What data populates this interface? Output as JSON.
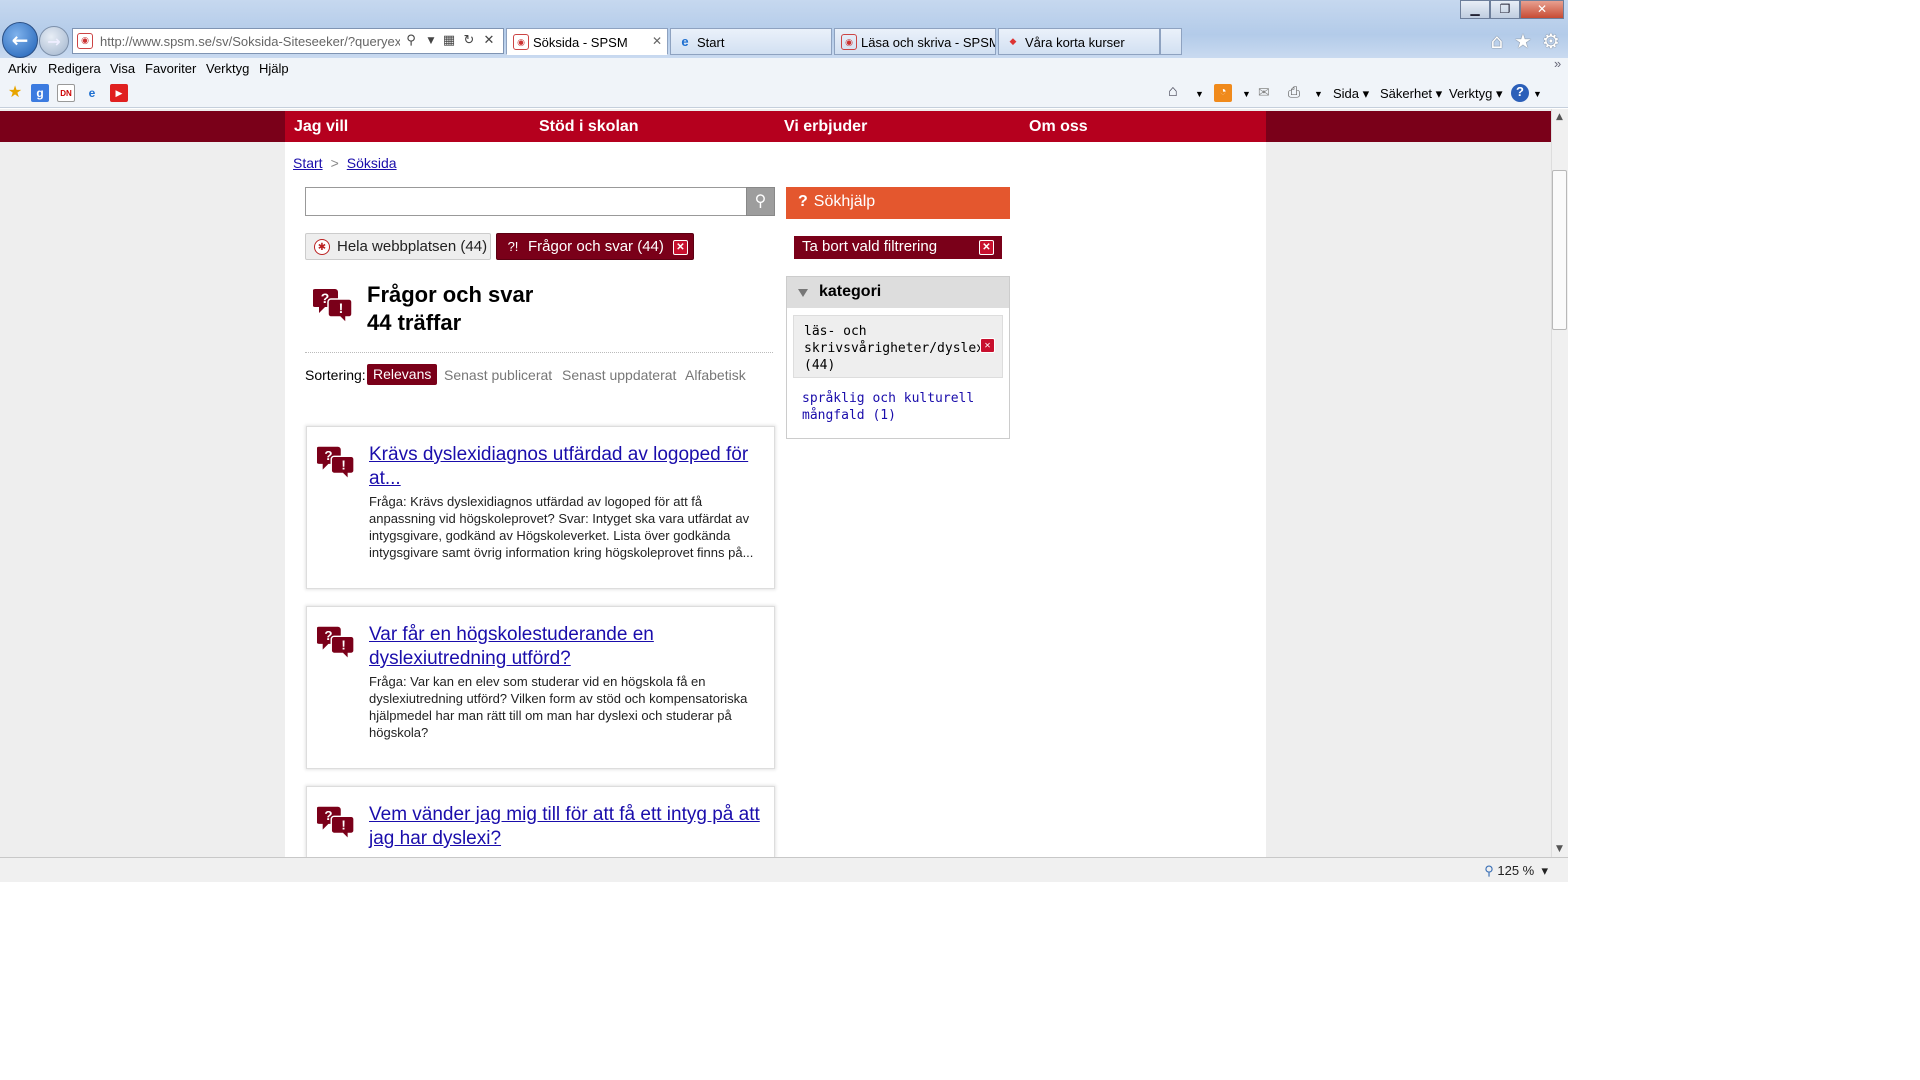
{
  "browser": {
    "address": "http://www.spsm.se/sv/Soksida-Siteseeker/?queryex=(h",
    "tabs": [
      {
        "label": "Söksida - SPSM"
      },
      {
        "label": "Start"
      },
      {
        "label": "Läsa och skriva - SPSM"
      },
      {
        "label": "Våra korta kurser"
      }
    ],
    "menu": [
      "Arkiv",
      "Redigera",
      "Visa",
      "Favoriter",
      "Verktyg",
      "Hjälp"
    ],
    "commands": {
      "page": "Sida",
      "safety": "Säkerhet",
      "tools": "Verktyg"
    },
    "zoom": "125 %"
  },
  "site": {
    "nav": [
      "Jag vill",
      "Stöd i skolan",
      "Vi erbjuder",
      "Om oss"
    ],
    "breadcrumb": {
      "start": "Start",
      "sep": ">",
      "current": "Söksida"
    },
    "search": {
      "value": "",
      "help_label": "Sökhjälp"
    },
    "filters": {
      "whole_site": "Hela webbplatsen (44)",
      "qa": "Frågor och svar (44)",
      "remove": "Ta bort vald filtrering"
    },
    "category": {
      "heading": "kategori",
      "selected": "läs- och skrivsvårigheter/dyslexi (44)",
      "other": "språklig och kulturell mångfald (1)"
    },
    "results": {
      "title": "Frågor och svar",
      "count": "44 träffar"
    },
    "sort": {
      "label": "Sortering:",
      "options": [
        "Relevans",
        "Senast publicerat",
        "Senast uppdaterat",
        "Alfabetisk"
      ]
    },
    "items": [
      {
        "title": "Krävs dyslexidiagnos utfärdad av logoped för at...",
        "text": "Fråga: Krävs dyslexidiagnos utfärdad av logoped för att få anpassning vid högskoleprovet? Svar: Intyget ska vara utfärdat av intygsgivare, godkänd av Högskoleverket. Lista över godkända intygsgivare samt övrig information kring högskoleprovet finns på..."
      },
      {
        "title": "Var får en högskolestuderande en dyslexiutredning utförd?",
        "text": "Fråga: Var kan en elev som studerar vid en högskola få en dyslexiutredning utförd? Vilken form av stöd och kompensatoriska hjälpmedel har man rätt till om man har dyslexi och studerar på högskola?"
      },
      {
        "title": "Vem vänder jag mig till för att få ett intyg på att jag har dyslexi?",
        "text": ""
      }
    ]
  },
  "colors": {
    "brand_red": "#b5001e",
    "dark_red": "#7a0019",
    "help_orange": "#e4572e",
    "link": "#1a0dab"
  }
}
